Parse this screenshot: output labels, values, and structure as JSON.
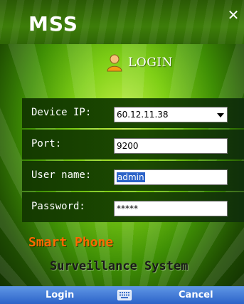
{
  "app": {
    "brand": "MSS"
  },
  "login": {
    "title": "LOGIN"
  },
  "form": {
    "device_ip": {
      "label": "Device IP:",
      "value": "60.12.11.38"
    },
    "port": {
      "label": "Port:",
      "value": "9200"
    },
    "username": {
      "label": "User name:",
      "value": "admin"
    },
    "password": {
      "label": "Password:",
      "value": "*****"
    }
  },
  "tagline": {
    "line1": "Smart Phone",
    "line2": "Surveillance System"
  },
  "softkeys": {
    "left": "Login",
    "right": "Cancel"
  },
  "colors": {
    "accent_orange": "#ff6a00",
    "softkey_blue": "#2c63c8",
    "text_white": "#ffffff"
  },
  "icons": {
    "close": "close-icon",
    "user": "user-icon",
    "dropdown": "chevron-down-icon",
    "keyboard": "keyboard-icon"
  }
}
